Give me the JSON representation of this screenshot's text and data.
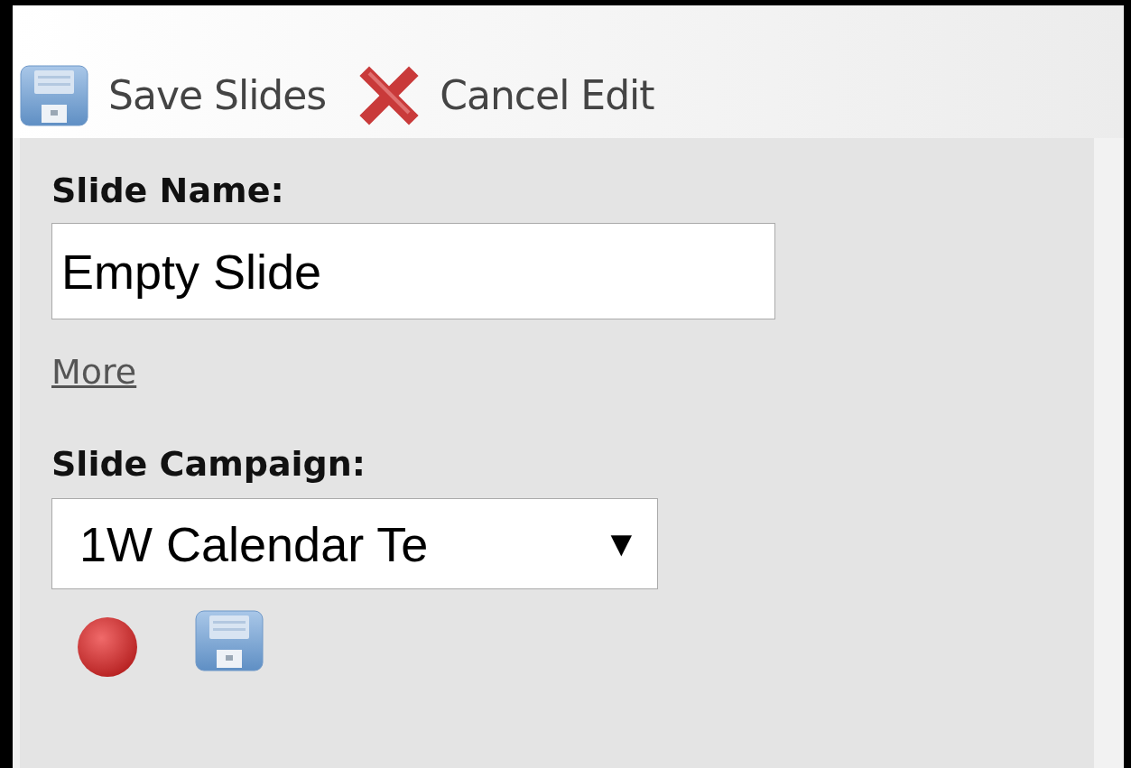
{
  "toolbar": {
    "buttons": [
      {
        "kind": "save",
        "label": "Save Slides"
      },
      {
        "kind": "cancel",
        "label": "Cancel Edit"
      }
    ]
  },
  "form": {
    "name_label": "Slide Name:",
    "name_value": "Empty Slide",
    "more_link": "More",
    "campaign_label": "Slide Campaign:",
    "campaign_value": "1W Calendar Te",
    "campaign_arrow": "▼"
  }
}
